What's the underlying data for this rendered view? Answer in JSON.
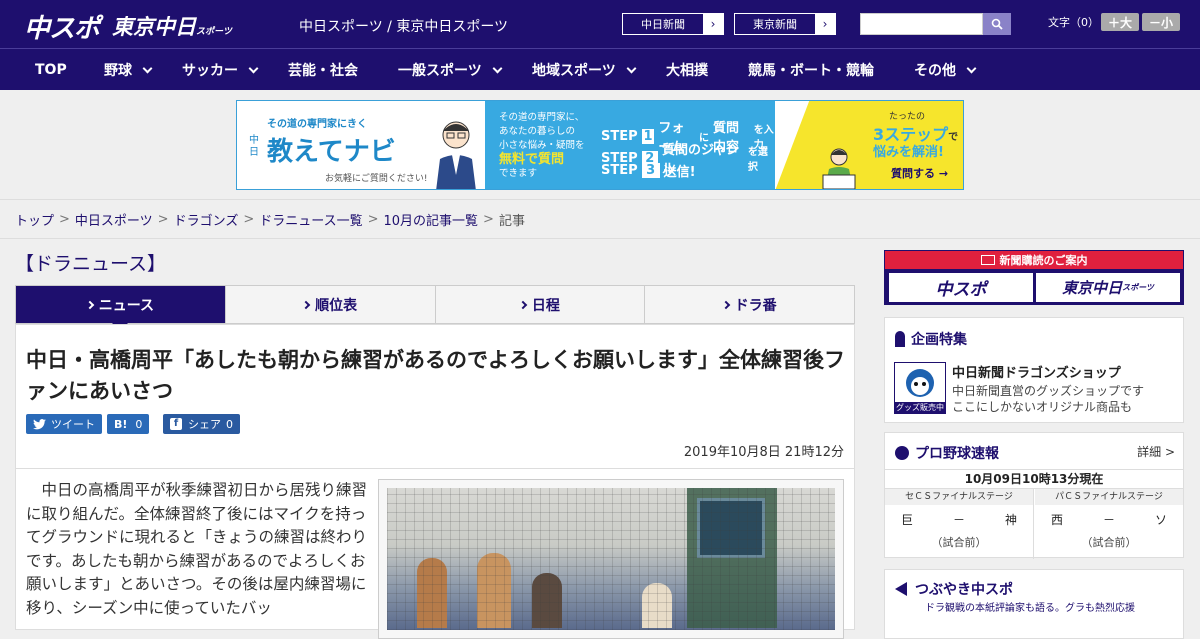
{
  "header": {
    "logo_chuspo": "中スポ",
    "logo_tokyo": "東京中日",
    "logo_tokyo_sub": "スポーツ",
    "site_names": "中日スポーツ / 東京中日スポーツ",
    "paper_links": [
      {
        "label": "中日新聞"
      },
      {
        "label": "東京新聞"
      }
    ],
    "search_placeholder": "",
    "font_size_label": "文字（0）",
    "font_bigger": "＋大",
    "font_smaller": "－小"
  },
  "nav": {
    "items": [
      {
        "label": "TOP",
        "has_dropdown": false
      },
      {
        "label": "野球",
        "has_dropdown": true
      },
      {
        "label": "サッカー",
        "has_dropdown": true
      },
      {
        "label": "芸能・社会",
        "has_dropdown": false
      },
      {
        "label": "一般スポーツ",
        "has_dropdown": true
      },
      {
        "label": "地域スポーツ",
        "has_dropdown": true
      },
      {
        "label": "大相撲",
        "has_dropdown": false
      },
      {
        "label": "競馬・ボート・競輪",
        "has_dropdown": false
      },
      {
        "label": "その他",
        "has_dropdown": true
      }
    ]
  },
  "banner": {
    "tagline": "その道の専門家にきく",
    "brand_prefix": "中日",
    "brand": "教えてナビ",
    "note": "お気軽にご質問ください!",
    "mid_line1": "その道の専門家に、",
    "mid_line2": "あなたの暮らしの",
    "mid_line3": "小さな悩み・疑問を",
    "mid_highlight": "無料で質問",
    "mid_line4": "できます",
    "steps": [
      {
        "label": "STEP",
        "num": "1",
        "text_a": "フォーム",
        "text_b": "に",
        "text_c": "質問内容",
        "text_d": "を入力"
      },
      {
        "label": "STEP",
        "num": "2",
        "text_a": "質問のジャンル",
        "text_b": "を選択"
      },
      {
        "label": "STEP",
        "num": "3",
        "text_a": "送信!"
      }
    ],
    "right_small": "たったの",
    "right_big": "3ステップ",
    "right_suffix": "で",
    "right_line2": "悩みを解消!",
    "right_button": "質問する"
  },
  "breadcrumb": [
    {
      "label": "トップ",
      "link": true
    },
    {
      "label": "中日スポーツ",
      "link": true
    },
    {
      "label": "ドラゴンズ",
      "link": true
    },
    {
      "label": "ドラニュース一覧",
      "link": true
    },
    {
      "label": "10月の記事一覧",
      "link": true
    },
    {
      "label": "記事",
      "link": false
    }
  ],
  "section_title": "【ドラニュース】",
  "tabs": [
    {
      "label": "ニュース",
      "active": true
    },
    {
      "label": "順位表",
      "active": false
    },
    {
      "label": "日程",
      "active": false
    },
    {
      "label": "ドラ番",
      "active": false
    }
  ],
  "article": {
    "headline": "中日・高橋周平「あしたも朝から練習があるのでよろしくお願いします」全体練習後ファンにあいさつ",
    "share": {
      "tweet": "ツイート",
      "hatena": "B!",
      "hatena_count": "0",
      "facebook": "シェア",
      "facebook_count": "0"
    },
    "date": "2019年10月8日 21時12分",
    "body": "中日の高橋周平が秋季練習初日から居残り練習に取り組んだ。全体練習終了後にはマイクを持ってグラウンドに現れると「きょうの練習は終わりです。あしたも朝から練習があるのでよろしくお願いします」とあいさつ。その後は屋内練習場に移り、シーズン中に使っていたバッ"
  },
  "sidebar": {
    "subscribe_heading": "新聞購読のご案内",
    "subscribe_chuspo": "中スポ",
    "subscribe_tokyo": "東京中日",
    "subscribe_tokyo_sub": "スポーツ",
    "special": {
      "title": "企画特集",
      "shop_badge": "グッズ販売中",
      "shop_title": "中日新聞ドラゴンズショップ",
      "shop_desc1": "中日新聞直営のグッズショップです",
      "shop_desc2": "ここにしかないオリジナル商品も"
    },
    "scores": {
      "title": "プロ野球速報",
      "detail": "詳細 >",
      "as_of": "10月09日10時13分現在",
      "games": [
        {
          "stage": "セＣＳファイナルステージ",
          "home": "巨",
          "dash": "－",
          "away": "神",
          "status": "（試合前）"
        },
        {
          "stage": "パＣＳファイナルステージ",
          "home": "西",
          "dash": "－",
          "away": "ソ",
          "status": "（試合前）"
        }
      ]
    },
    "tweet_section": {
      "title": "つぶやき中スポ",
      "desc": "ドラ観戦の本紙評論家も語る。グラも熱烈応援"
    }
  },
  "colors": {
    "brand_navy": "#1e0f6e",
    "accent_red": "#e0203e",
    "banner_blue": "#38a9e1",
    "banner_yellow": "#f6e52c"
  }
}
